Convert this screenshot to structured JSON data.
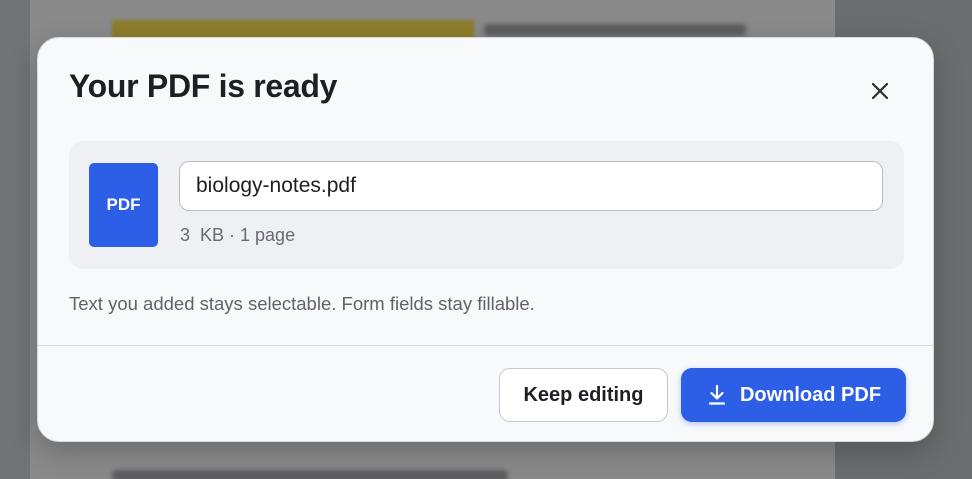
{
  "dialog": {
    "title": "Your PDF is ready",
    "close_icon": "close-icon",
    "file": {
      "badge_label": "PDF",
      "filename": "biology-notes.pdf",
      "meta": "3  KB · 1 page"
    },
    "note": "Text you added stays selectable. Form fields stay fillable.",
    "buttons": {
      "keep_editing": "Keep editing",
      "download": "Download PDF",
      "download_icon": "download-icon"
    }
  },
  "colors": {
    "accent": "#2c5ee6",
    "overlay": "#6f7072",
    "modal_bg": "#f8f9fb",
    "card_bg": "#eef0f4"
  }
}
